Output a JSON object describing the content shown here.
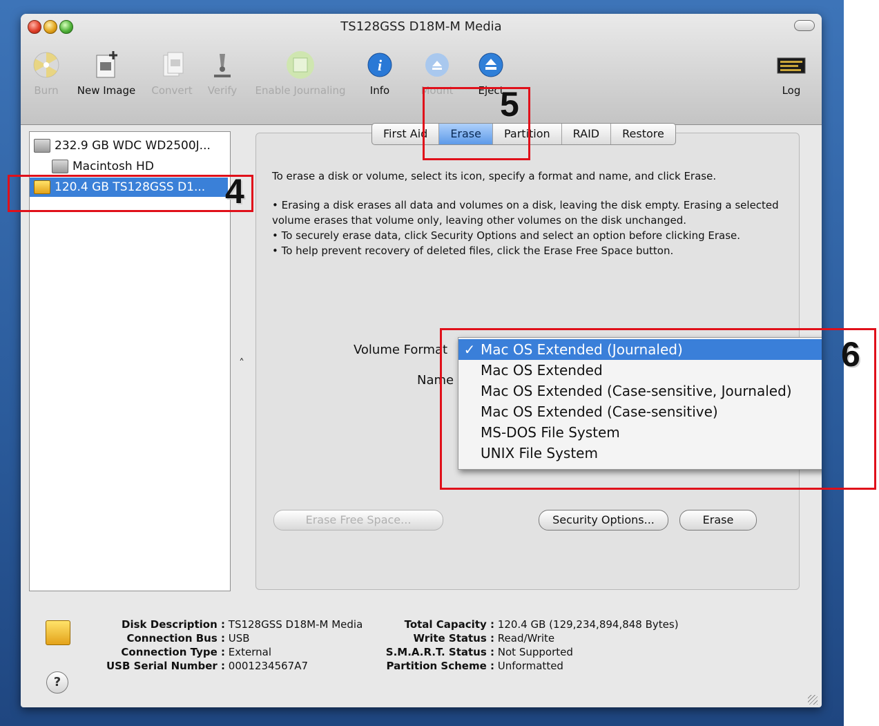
{
  "window": {
    "title": "TS128GSS D18M-M Media"
  },
  "toolbar": {
    "items": [
      {
        "label": "Burn",
        "icon": "burn-icon",
        "enabled": false
      },
      {
        "label": "New Image",
        "icon": "new-image-icon",
        "enabled": true
      },
      {
        "label": "Convert",
        "icon": "convert-icon",
        "enabled": false
      },
      {
        "label": "Verify",
        "icon": "microscope-icon",
        "enabled": false
      },
      {
        "label": "Enable Journaling",
        "icon": "journaling-icon",
        "enabled": false
      },
      {
        "label": "Info",
        "icon": "info-icon",
        "enabled": true
      },
      {
        "label": "Mount",
        "icon": "mount-icon",
        "enabled": false
      },
      {
        "label": "Eject",
        "icon": "eject-icon",
        "enabled": true
      },
      {
        "label": "Log",
        "icon": "log-icon",
        "enabled": true
      }
    ]
  },
  "sidebar": {
    "items": [
      {
        "label": "232.9 GB WDC WD2500J...",
        "icon": "hard-disk-icon"
      },
      {
        "label": "Macintosh HD",
        "icon": "volume-icon"
      },
      {
        "label": "120.4 GB TS128GSS D1...",
        "icon": "usb-drive-icon",
        "selected": true
      }
    ]
  },
  "tabs": [
    {
      "label": "First Aid"
    },
    {
      "label": "Erase",
      "active": true
    },
    {
      "label": "Partition"
    },
    {
      "label": "RAID"
    },
    {
      "label": "Restore"
    }
  ],
  "erase": {
    "intro": "To erase a disk or volume, select its icon, specify a format and name, and click Erase.",
    "bullet1": "• Erasing a disk erases all data and volumes on a disk, leaving the disk empty. Erasing a selected volume erases that volume only, leaving other volumes on the disk unchanged.",
    "bullet2": "• To securely erase data, click Security Options and select an option before clicking Erase.",
    "bullet3": "• To help prevent recovery of deleted files, click the Erase Free Space button.",
    "volume_format_label": "Volume Format",
    "name_label": "Name",
    "format_options": [
      {
        "label": "Mac OS Extended (Journaled)",
        "selected": true,
        "check": "✓"
      },
      {
        "label": "Mac OS Extended"
      },
      {
        "label": "Mac OS Extended (Case-sensitive, Journaled)"
      },
      {
        "label": "Mac OS Extended (Case-sensitive)"
      },
      {
        "label": "MS-DOS File System"
      },
      {
        "label": "UNIX File System"
      }
    ],
    "buttons": {
      "erase_free_space": "Erase Free Space...",
      "security_options": "Security Options...",
      "erase": "Erase"
    }
  },
  "details": {
    "left": [
      {
        "key": "Disk Description :",
        "value": "TS128GSS D18M-M Media"
      },
      {
        "key": "Connection Bus :",
        "value": "USB"
      },
      {
        "key": "Connection Type :",
        "value": "External"
      },
      {
        "key": "USB Serial Number :",
        "value": "0001234567A7"
      }
    ],
    "right": [
      {
        "key": "Total Capacity :",
        "value": "120.4 GB (129,234,894,848 Bytes)"
      },
      {
        "key": "Write Status :",
        "value": "Read/Write"
      },
      {
        "key": "S.M.A.R.T. Status :",
        "value": "Not Supported"
      },
      {
        "key": "Partition Scheme :",
        "value": "Unformatted"
      }
    ],
    "help_label": "?"
  },
  "annotations": [
    {
      "number": "4"
    },
    {
      "number": "5"
    },
    {
      "number": "6"
    }
  ],
  "colors": {
    "selection": "#3a80d8",
    "annotation": "#e0101a"
  }
}
